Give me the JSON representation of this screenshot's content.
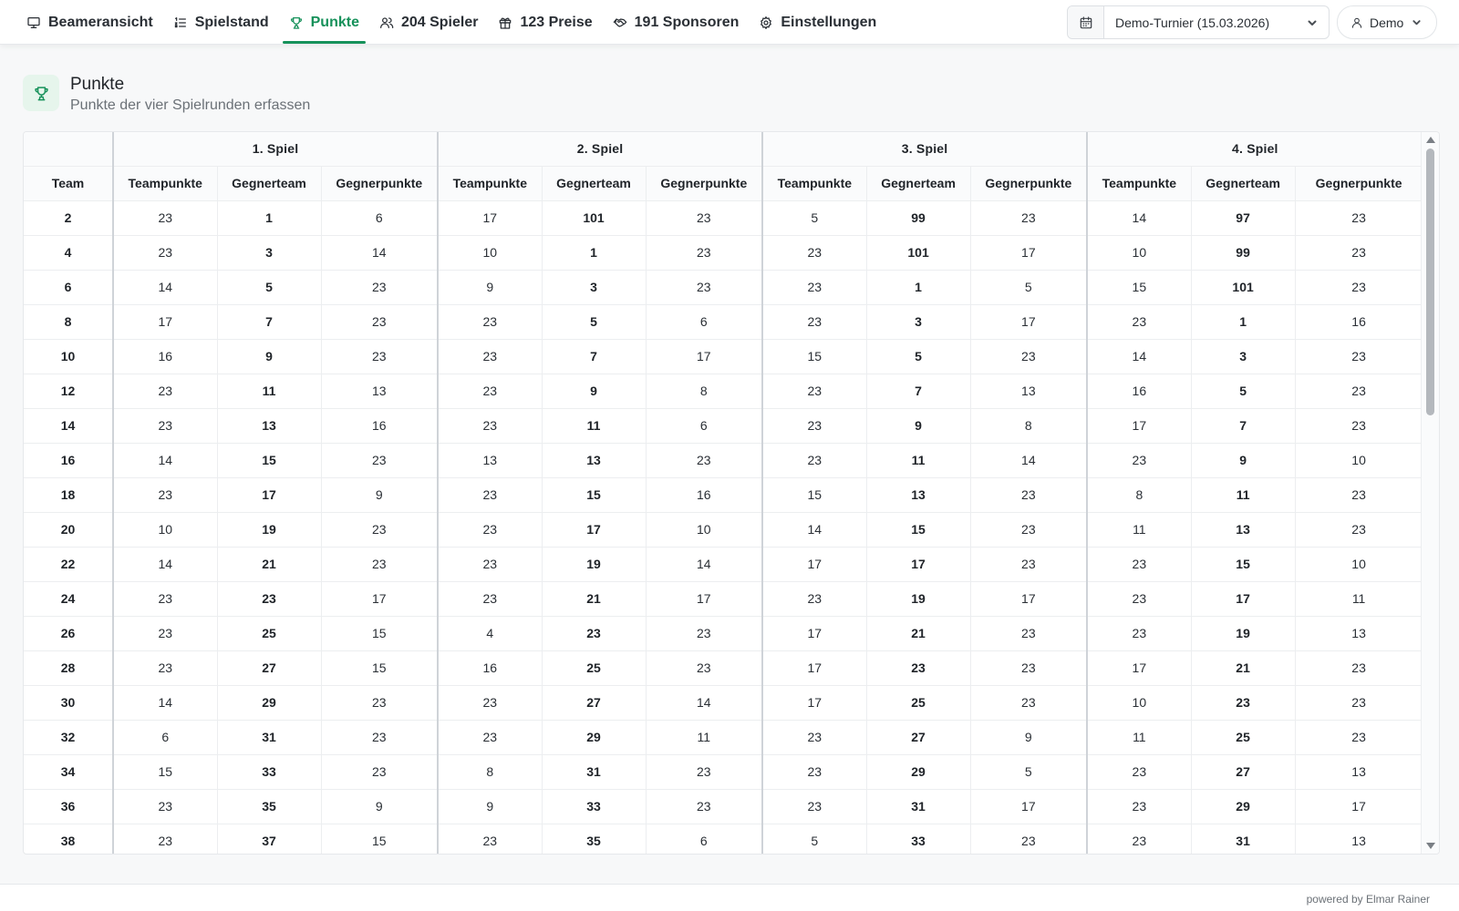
{
  "nav": {
    "tabs": [
      {
        "label": "Beameransicht",
        "icon": "monitor-icon"
      },
      {
        "label": "Spielstand",
        "icon": "list-ordered-icon"
      },
      {
        "label": "Punkte",
        "icon": "trophy-icon",
        "active": true
      },
      {
        "label": "204 Spieler",
        "icon": "users-icon"
      },
      {
        "label": "123 Preise",
        "icon": "gift-icon"
      },
      {
        "label": "191 Sponsoren",
        "icon": "handshake-icon"
      },
      {
        "label": "Einstellungen",
        "icon": "gear-icon"
      }
    ],
    "tournament_label": "Demo-Turnier (15.03.2026)",
    "user_label": "Demo"
  },
  "page": {
    "title": "Punkte",
    "subtitle": "Punkte der vier Spielrunden erfassen"
  },
  "colors": {
    "accent": "#16915a",
    "accent_bg": "#e6f5ec"
  },
  "table": {
    "team_header": "Team",
    "games": [
      "1. Spiel",
      "2. Spiel",
      "3. Spiel",
      "4. Spiel"
    ],
    "sub_headers": [
      "Teampunkte",
      "Gegnerteam",
      "Gegnerpunkte"
    ],
    "rows": [
      {
        "team": "2",
        "g": [
          [
            "23",
            "1",
            "6"
          ],
          [
            "17",
            "101",
            "23"
          ],
          [
            "5",
            "99",
            "23"
          ],
          [
            "14",
            "97",
            "23"
          ]
        ]
      },
      {
        "team": "4",
        "g": [
          [
            "23",
            "3",
            "14"
          ],
          [
            "10",
            "1",
            "23"
          ],
          [
            "23",
            "101",
            "17"
          ],
          [
            "10",
            "99",
            "23"
          ]
        ]
      },
      {
        "team": "6",
        "g": [
          [
            "14",
            "5",
            "23"
          ],
          [
            "9",
            "3",
            "23"
          ],
          [
            "23",
            "1",
            "5"
          ],
          [
            "15",
            "101",
            "23"
          ]
        ]
      },
      {
        "team": "8",
        "g": [
          [
            "17",
            "7",
            "23"
          ],
          [
            "23",
            "5",
            "6"
          ],
          [
            "23",
            "3",
            "17"
          ],
          [
            "23",
            "1",
            "16"
          ]
        ]
      },
      {
        "team": "10",
        "g": [
          [
            "16",
            "9",
            "23"
          ],
          [
            "23",
            "7",
            "17"
          ],
          [
            "15",
            "5",
            "23"
          ],
          [
            "14",
            "3",
            "23"
          ]
        ]
      },
      {
        "team": "12",
        "g": [
          [
            "23",
            "11",
            "13"
          ],
          [
            "23",
            "9",
            "8"
          ],
          [
            "23",
            "7",
            "13"
          ],
          [
            "16",
            "5",
            "23"
          ]
        ]
      },
      {
        "team": "14",
        "g": [
          [
            "23",
            "13",
            "16"
          ],
          [
            "23",
            "11",
            "6"
          ],
          [
            "23",
            "9",
            "8"
          ],
          [
            "17",
            "7",
            "23"
          ]
        ]
      },
      {
        "team": "16",
        "g": [
          [
            "14",
            "15",
            "23"
          ],
          [
            "13",
            "13",
            "23"
          ],
          [
            "23",
            "11",
            "14"
          ],
          [
            "23",
            "9",
            "10"
          ]
        ]
      },
      {
        "team": "18",
        "g": [
          [
            "23",
            "17",
            "9"
          ],
          [
            "23",
            "15",
            "16"
          ],
          [
            "15",
            "13",
            "23"
          ],
          [
            "8",
            "11",
            "23"
          ]
        ]
      },
      {
        "team": "20",
        "g": [
          [
            "10",
            "19",
            "23"
          ],
          [
            "23",
            "17",
            "10"
          ],
          [
            "14",
            "15",
            "23"
          ],
          [
            "11",
            "13",
            "23"
          ]
        ]
      },
      {
        "team": "22",
        "g": [
          [
            "14",
            "21",
            "23"
          ],
          [
            "23",
            "19",
            "14"
          ],
          [
            "17",
            "17",
            "23"
          ],
          [
            "23",
            "15",
            "10"
          ]
        ]
      },
      {
        "team": "24",
        "g": [
          [
            "23",
            "23",
            "17"
          ],
          [
            "23",
            "21",
            "17"
          ],
          [
            "23",
            "19",
            "17"
          ],
          [
            "23",
            "17",
            "11"
          ]
        ]
      },
      {
        "team": "26",
        "g": [
          [
            "23",
            "25",
            "15"
          ],
          [
            "4",
            "23",
            "23"
          ],
          [
            "17",
            "21",
            "23"
          ],
          [
            "23",
            "19",
            "13"
          ]
        ]
      },
      {
        "team": "28",
        "g": [
          [
            "23",
            "27",
            "15"
          ],
          [
            "16",
            "25",
            "23"
          ],
          [
            "17",
            "23",
            "23"
          ],
          [
            "17",
            "21",
            "23"
          ]
        ]
      },
      {
        "team": "30",
        "g": [
          [
            "14",
            "29",
            "23"
          ],
          [
            "23",
            "27",
            "14"
          ],
          [
            "17",
            "25",
            "23"
          ],
          [
            "10",
            "23",
            "23"
          ]
        ]
      },
      {
        "team": "32",
        "g": [
          [
            "6",
            "31",
            "23"
          ],
          [
            "23",
            "29",
            "11"
          ],
          [
            "23",
            "27",
            "9"
          ],
          [
            "11",
            "25",
            "23"
          ]
        ]
      },
      {
        "team": "34",
        "g": [
          [
            "15",
            "33",
            "23"
          ],
          [
            "8",
            "31",
            "23"
          ],
          [
            "23",
            "29",
            "5"
          ],
          [
            "23",
            "27",
            "13"
          ]
        ]
      },
      {
        "team": "36",
        "g": [
          [
            "23",
            "35",
            "9"
          ],
          [
            "9",
            "33",
            "23"
          ],
          [
            "23",
            "31",
            "17"
          ],
          [
            "23",
            "29",
            "17"
          ]
        ]
      },
      {
        "team": "38",
        "g": [
          [
            "23",
            "37",
            "15"
          ],
          [
            "23",
            "35",
            "6"
          ],
          [
            "5",
            "33",
            "23"
          ],
          [
            "23",
            "31",
            "13"
          ]
        ]
      }
    ]
  },
  "footer": {
    "text": "powered by Elmar Rainer"
  }
}
